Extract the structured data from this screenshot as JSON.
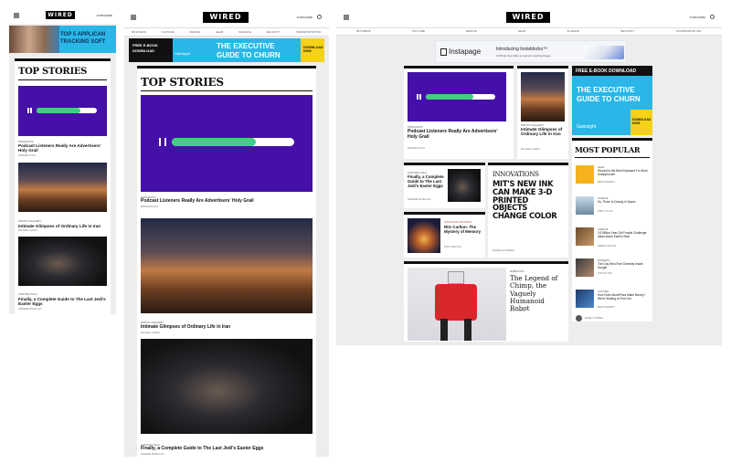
{
  "brand": {
    "logo": "WIRED",
    "subscribe": "SUBSCRIBE"
  },
  "nav": [
    "BUSINESS",
    "CULTURE",
    "DESIGN",
    "GEAR",
    "SCIENCE",
    "SECURITY",
    "TRANSPORTATION"
  ],
  "mobile": {
    "ad_text": "TOP 5 APPLICAN TRACKING SOFT",
    "section": "TOP STORIES",
    "stories": [
      {
        "kicker": "PODCASTS",
        "headline": "Podcast Listeners Really Are Advertisers' Holy Grail",
        "byline": "MIRANDA KATZ"
      },
      {
        "kicker": "PHOTO GALLERY",
        "headline": "Intimate Glimpses of Ordinary Life in Iran",
        "byline": "MICHAEL HARDY"
      },
      {
        "kicker": "CANTINA TALK",
        "headline": "Finally, a Complete Guide to The Last Jedi's Easter Eggs",
        "byline": "GRAEME MCMILLAN"
      }
    ]
  },
  "tablet": {
    "ad": {
      "badge": "FREE E-BOOK DOWNLOAD",
      "brand": "Gainsight",
      "line1": "THE EXECUTIVE",
      "line2": "GUIDE TO CHURN",
      "cta": "DOWNLOAD NOW"
    },
    "section": "TOP STORIES",
    "stories": [
      {
        "kicker": "PODCASTS",
        "headline": "Podcast Listeners Really Are Advertisers' Holy Grail",
        "byline": "MIRANDA KATZ"
      },
      {
        "kicker": "PHOTO GALLERY",
        "headline": "Intimate Glimpses of Ordinary Life in Iran",
        "byline": "MICHAEL HARDY"
      },
      {
        "kicker": "CANTINA TALK",
        "headline": "Finally, a Complete Guide to The Last Jedi's Easter Eggs",
        "byline": "GRAEME MCMILLAN"
      }
    ]
  },
  "desktop": {
    "subscribe": "SUBSCRIBE",
    "leaderboard": {
      "brand": "Instapage",
      "line1": "Introducing Instablocks™",
      "line2": "A Whole New Way to Launch Landing Pages"
    },
    "cards": [
      {
        "kicker": "PODCASTS",
        "headline": "Podcast Listeners Really Are Advertisers' Holy Grail",
        "byline": "MIRANDA KATZ"
      },
      {
        "kicker": "PHOTO GALLERY",
        "headline": "Intimate Glimpses of Ordinary Life in Iran",
        "byline": "MICHAEL HARDY"
      },
      {
        "kicker": "CANTINA TALK",
        "headline": "Finally, a Complete Guide to The Last Jedi's Easter Eggs",
        "byline": "GRAEME MCMILLAN"
      },
      {
        "kicker": "SPONSOR CONTENT",
        "headline": "Ritz Carlton: The Mystery of Memory",
        "byline": "RITZ CARLTON"
      },
      {
        "kicker": "INNOVATIONS",
        "headline": "MIT'S NEW INK CAN MAKE 3-D PRINTED OBJECTS CHANGE COLOR",
        "byline": "DANIELLE PARDEN"
      },
      {
        "kicker": "ROBOTICS",
        "headline": "The Legend of Chimp, the Vaguely Humanoid Robot",
        "byline": "MATT SIMON"
      }
    ],
    "ad": {
      "badge": "FREE E-BOOK DOWNLOAD",
      "brand": "Gainsight",
      "line1": "THE EXECUTIVE",
      "line2": "GUIDE TO CHURN",
      "cta": "DOWNLOAD NOW"
    },
    "popular_title": "MOST POPULAR",
    "popular": [
      {
        "kicker": "GEAR",
        "headline": "Gboard Is the Best Keyboard For Most Smartphones",
        "byline": "BRIAN BARRETT"
      },
      {
        "kicker": "SCIENCE",
        "headline": "So, There Is Gravity in Space",
        "byline": "RHETT ALLAIN"
      },
      {
        "kicker": "SCIENCE",
        "headline": "3.5 Billion-Year-Old Fossils Challenge Ideas About Earth's Start",
        "byline": "REBECCA BOYLE"
      },
      {
        "kicker": "BUSINESS",
        "headline": "The Guy Who Ever Diversity Inside Google",
        "byline": "NITASHA TIKU"
      },
      {
        "kicker": "CULTURE",
        "headline": "How Does MoviePass Make Money? We're Starting to Find Out",
        "byline": "BRIAN BARRETT"
      }
    ],
    "more": "MORE STORIES"
  },
  "colors": {
    "purple": "#4410a8",
    "green": "#3fd07a",
    "adblue": "#2ab7e8",
    "yellow": "#f5d21a"
  }
}
